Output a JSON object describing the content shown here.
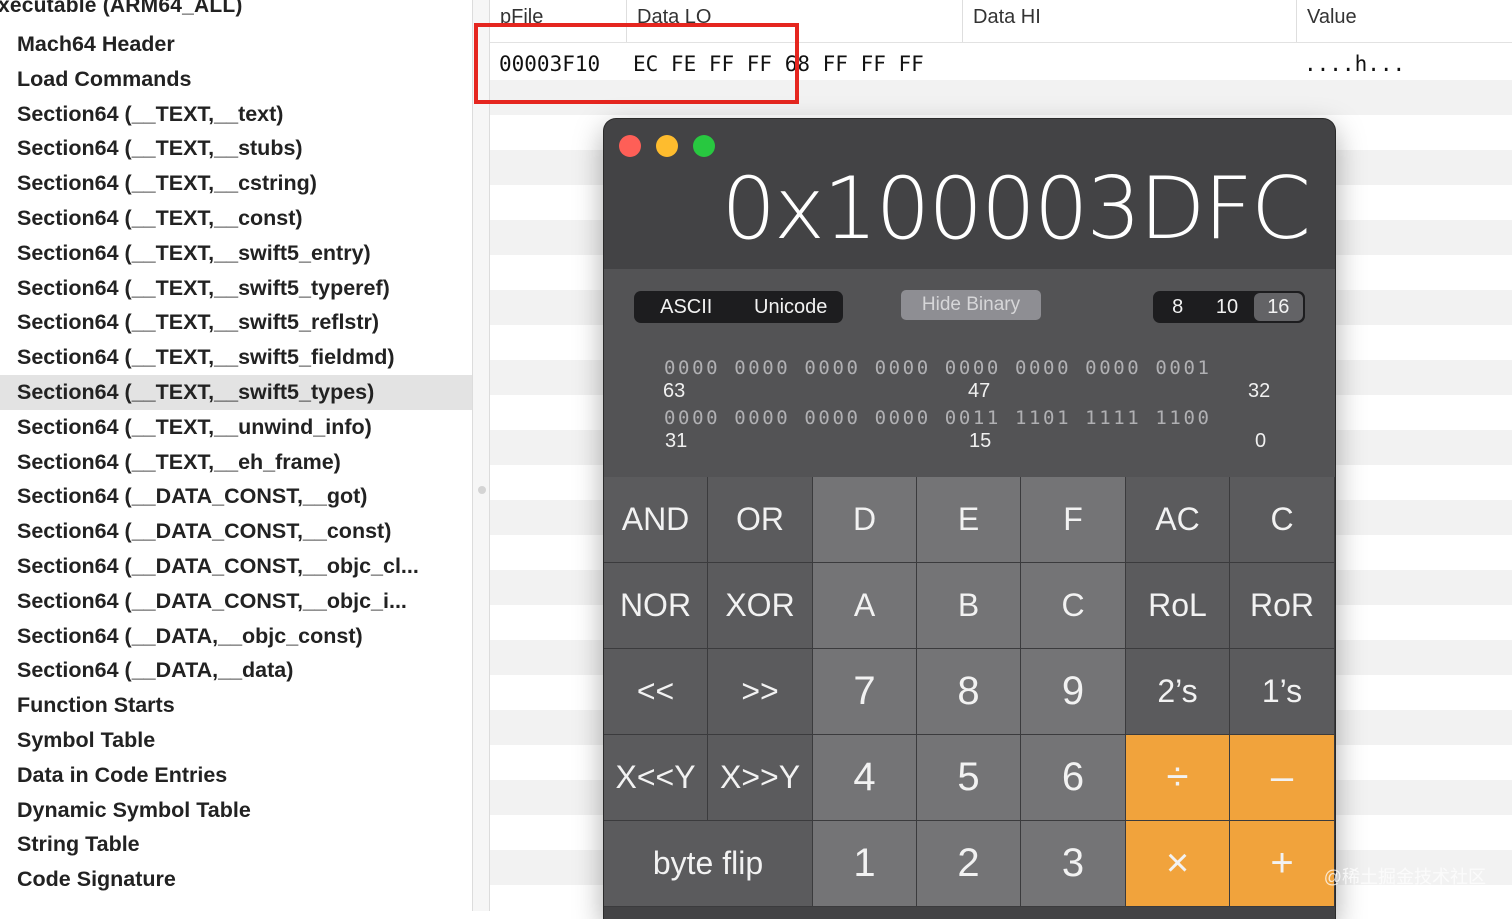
{
  "sidebar": {
    "file_title": "xecutable  (ARM64_ALL)",
    "items": [
      {
        "label": "Mach64 Header"
      },
      {
        "label": "Load Commands"
      },
      {
        "label": "Section64 (__TEXT,__text)"
      },
      {
        "label": "Section64 (__TEXT,__stubs)"
      },
      {
        "label": "Section64 (__TEXT,__cstring)"
      },
      {
        "label": "Section64 (__TEXT,__const)"
      },
      {
        "label": "Section64 (__TEXT,__swift5_entry)"
      },
      {
        "label": "Section64 (__TEXT,__swift5_typeref)"
      },
      {
        "label": "Section64 (__TEXT,__swift5_reflstr)"
      },
      {
        "label": "Section64 (__TEXT,__swift5_fieldmd)"
      },
      {
        "label": "Section64 (__TEXT,__swift5_types)",
        "selected": true
      },
      {
        "label": "Section64 (__TEXT,__unwind_info)"
      },
      {
        "label": "Section64 (__TEXT,__eh_frame)"
      },
      {
        "label": "Section64 (__DATA_CONST,__got)"
      },
      {
        "label": "Section64 (__DATA_CONST,__const)"
      },
      {
        "label": "Section64 (__DATA_CONST,__objc_cl..."
      },
      {
        "label": "Section64 (__DATA_CONST,__objc_i..."
      },
      {
        "label": "Section64 (__DATA,__objc_const)"
      },
      {
        "label": "Section64 (__DATA,__data)"
      },
      {
        "label": "Function Starts"
      },
      {
        "label": "Symbol Table"
      },
      {
        "label": "Data in Code Entries"
      },
      {
        "label": "Dynamic Symbol Table"
      },
      {
        "label": "String Table"
      },
      {
        "label": "Code Signature"
      }
    ]
  },
  "table": {
    "headers": [
      "pFile",
      "Data LO",
      "Data HI",
      "Value"
    ],
    "row": {
      "pfile": "00003F10",
      "data_lo": "EC FE FF FF 68 FF FF FF",
      "data_hi": "",
      "value": "....h..."
    }
  },
  "calculator": {
    "display": "0x100003DFC",
    "encoding": [
      "ASCII",
      "Unicode"
    ],
    "hide_binary": "Hide Binary",
    "bases": [
      "8",
      "10",
      "16"
    ],
    "active_base": "16",
    "binary_rows": [
      {
        "bits": "0000 0000 0000 0000 0000 0000 0000 0001",
        "left": "63",
        "mid": "47",
        "right": "32"
      },
      {
        "bits": "0000 0000 0000 0000 0011 1101 1111 1100",
        "left": "31",
        "mid": "15",
        "right": "0"
      }
    ],
    "keys": {
      "and": "AND",
      "or": "OR",
      "d": "D",
      "e": "E",
      "f": "F",
      "ac": "AC",
      "c_clear": "C",
      "nor": "NOR",
      "xor": "XOR",
      "a": "A",
      "b": "B",
      "c_hex": "C",
      "rol": "RoL",
      "ror": "RoR",
      "shl": "<<",
      "shr": ">>",
      "seven": "7",
      "eight": "8",
      "nine": "9",
      "twos": "2’s",
      "ones": "1’s",
      "xshl": "X<<Y",
      "xshr": "X>>Y",
      "four": "4",
      "five": "5",
      "six": "6",
      "divide": "÷",
      "minus": "–",
      "byte_flip": "byte flip",
      "one": "1",
      "two": "2",
      "three": "3",
      "times": "×",
      "plus": "+"
    }
  },
  "watermark": "@稀土掘金技术社区",
  "colors": {
    "highlight_border": "#e5261f",
    "operator_orange": "#f1a33c",
    "calc_body": "#434345"
  }
}
